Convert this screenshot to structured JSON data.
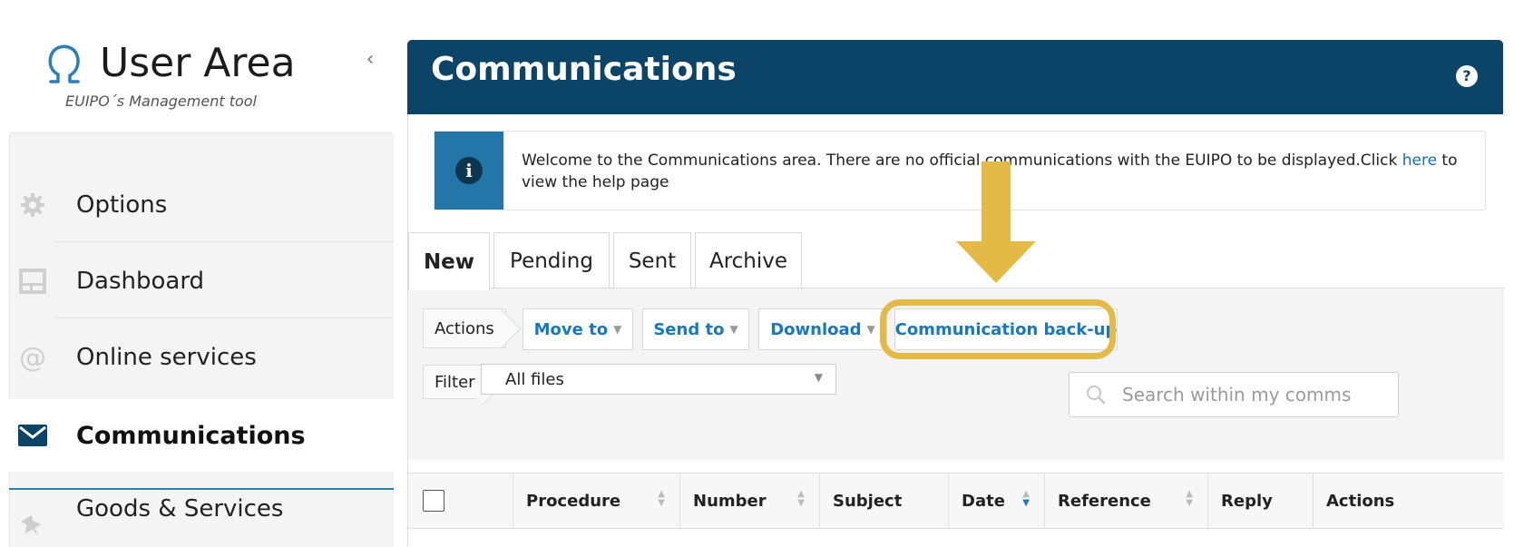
{
  "sidebar": {
    "logo_title": "User Area",
    "logo_subtitle": "EUIPO´s Management tool",
    "collapse_icon": "‹",
    "items": [
      {
        "label": "Options",
        "icon": "gear-icon"
      },
      {
        "label": "Dashboard",
        "icon": "dashboard-icon"
      },
      {
        "label": "Online services",
        "icon": "at-icon"
      },
      {
        "label": "Communications",
        "icon": "envelope-icon",
        "active": true
      },
      {
        "label": "Goods & Services",
        "icon": "pin-icon"
      }
    ]
  },
  "header": {
    "title": "Communications",
    "help_icon": "?"
  },
  "info": {
    "text_before": "Welcome to the Communications area. There are no official communications with the EUIPO to be displayed.Click ",
    "link": "here",
    "text_after": " to view the help page"
  },
  "tabs": [
    "New",
    "Pending",
    "Sent",
    "Archive"
  ],
  "toolbar": {
    "actions_label": "Actions",
    "move_to": "Move to",
    "send_to": "Send to",
    "download": "Download",
    "backup": "Communication back-up",
    "filter_label": "Filter",
    "filter_value": "All files",
    "search_placeholder": "Search within my comms"
  },
  "table": {
    "columns": [
      "Procedure",
      "Number",
      "Subject",
      "Date",
      "Reference",
      "Reply",
      "Actions"
    ]
  },
  "colors": {
    "header_bg": "#0b4467",
    "accent": "#1778c1",
    "info_block": "#2576a8",
    "highlight": "#e3ba45"
  }
}
